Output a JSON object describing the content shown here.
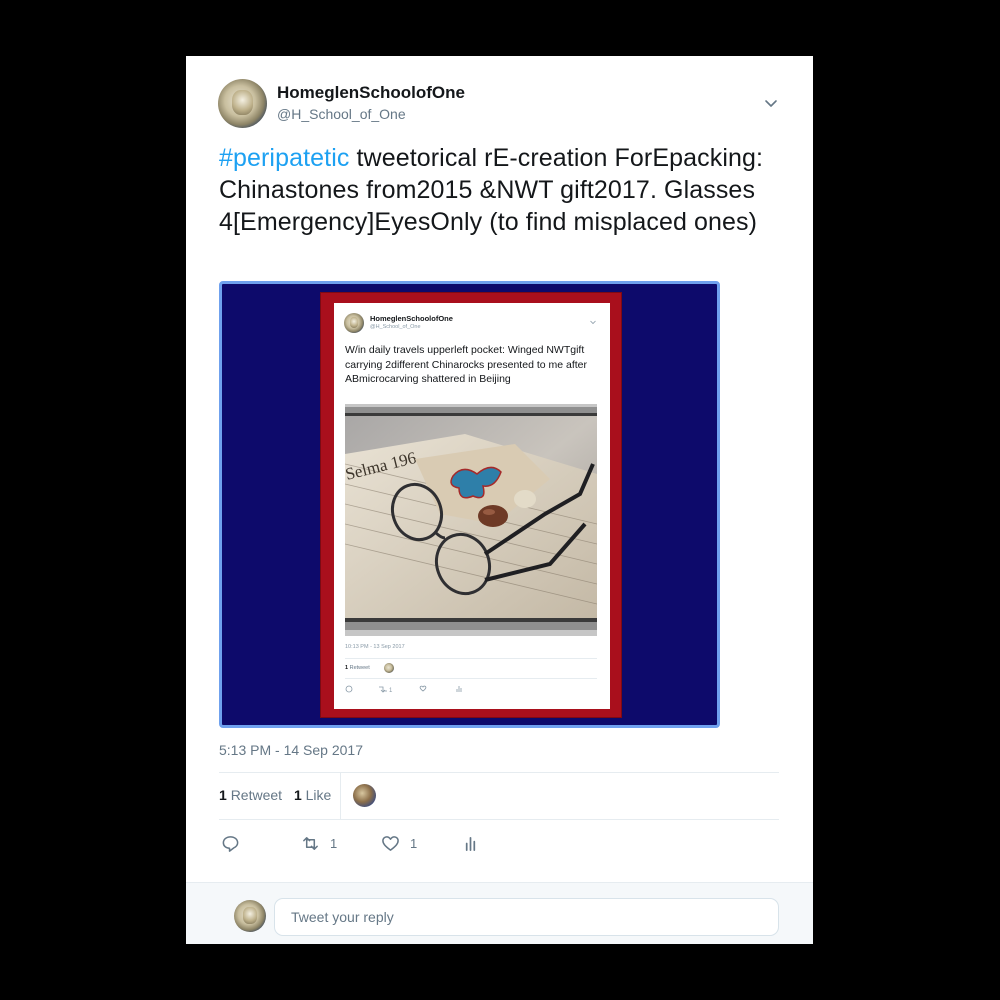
{
  "tweet": {
    "display_name": "HomeglenSchoolofOne",
    "handle": "@H_School_of_One",
    "hashtag": "#peripatetic",
    "text": " tweetorical rE-creation ForEpacking:  Chinastones from2015 &NWT gift2017. Glasses 4[Emergency]EyesOnly (to find misplaced ones)",
    "timestamp": "5:13 PM - 14 Sep 2017",
    "retweet_count": "1",
    "retweet_label": "Retweet",
    "like_count": "1",
    "like_label": "Like",
    "actions": {
      "reply_icon": "reply-icon",
      "retweet_icon": "retweet-icon",
      "retweet_count": "1",
      "like_icon": "heart-icon",
      "like_count": "1",
      "analytics_icon": "analytics-icon"
    },
    "menu_icon": "chevron-down-icon"
  },
  "embedded": {
    "display_name": "HomeglenSchoolofOne",
    "handle": "@H_School_of_One",
    "text": "W/in daily travels upperleft pocket: Winged NWTgift carrying 2different Chinarocks presented to me after ABmicrocarving shattered in Beijing",
    "photo_text": "Selma 196",
    "timestamp": "10:13 PM - 13 Sep 2017",
    "retweet_count": "1",
    "retweet_label": "Retweet",
    "retweets_in_actions": "1"
  },
  "reply": {
    "placeholder": "Tweet your reply"
  },
  "colors": {
    "accent": "#1da1f2",
    "media_border": "#6fa1ee",
    "media_bg": "#0d0a6b",
    "frame_red": "#a90f1c",
    "muted": "#657786"
  }
}
